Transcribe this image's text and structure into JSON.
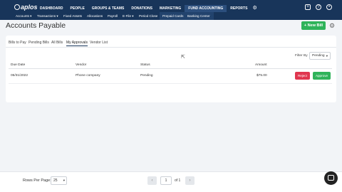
{
  "brand": {
    "logo_text": "aplos"
  },
  "nav": {
    "main": [
      "DASHBOARD",
      "PEOPLE",
      "GROUPS & TEAMS",
      "DONATIONS",
      "MARKETING",
      "FUND ACCOUNTING",
      "REPORTS"
    ],
    "active": "FUND ACCOUNTING",
    "sub": [
      "Accounts ▾",
      "Transactions ▾",
      "Fixed Assets",
      "Allocations",
      "Payroll",
      "E-File ▾",
      "Period Close",
      "Prepaid Cards",
      "Banking Center"
    ]
  },
  "page": {
    "title": "Accounts Payable",
    "new_bill_label": "+ New Bill"
  },
  "tabs": [
    "Bills to Pay",
    "Pending Bills",
    "All Bills",
    "My Approvals",
    "Vendor List"
  ],
  "active_tab": "My Approvals",
  "filter": {
    "label": "Filter By",
    "value": "Pending"
  },
  "table": {
    "columns": [
      "Due Date",
      "Vendor",
      "Status",
      "Amount"
    ],
    "rows": [
      {
        "due_date": "05/31/2022",
        "vendor": "Phone company",
        "status": "Pending",
        "amount": "$75.00"
      }
    ],
    "reject_label": "Reject",
    "approve_label": "Approve"
  },
  "pagination": {
    "rows_per_page_label": "Rows Per Page:",
    "rows_per_page": "25",
    "prev": "‹",
    "page": "1",
    "of_label": "of 1",
    "next": "›"
  },
  "colors": {
    "nav_bg": "#18355a",
    "primary_green": "#2fb35a",
    "reject_red": "#e0364f"
  }
}
